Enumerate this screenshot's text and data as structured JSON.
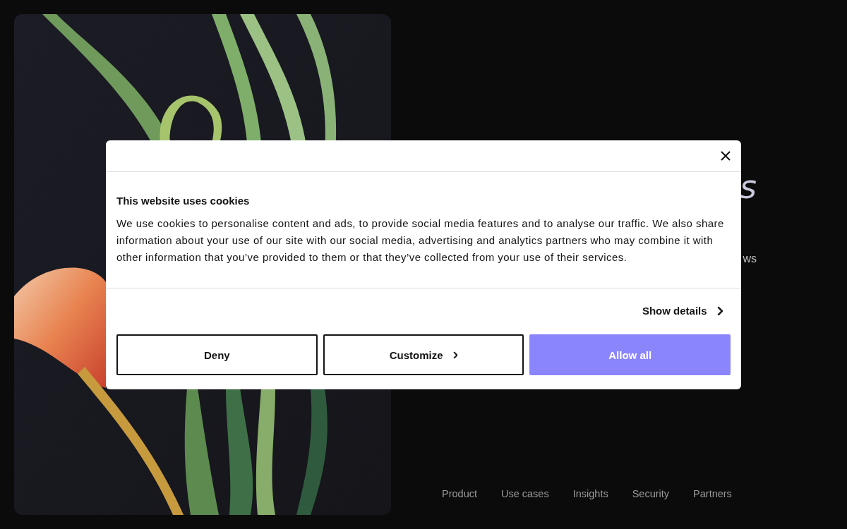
{
  "hero": {
    "heading_fragment": "s",
    "text_fragment": "ws"
  },
  "nav": {
    "items": [
      "Product",
      "Use cases",
      "Insights",
      "Security",
      "Partners"
    ]
  },
  "cookie_dialog": {
    "title": "This website uses cookies",
    "body": "We use cookies to personalise content and ads, to provide social media features and to analyse our traffic. We also share information about your use of our site with our social media, advertising and analytics partners who may combine it with other information that you’ve provided to them or that they’ve collected from your use of their services.",
    "details_link": "Show details",
    "buttons": [
      {
        "label": "Deny",
        "kind": "outline"
      },
      {
        "label": "Customize",
        "kind": "outline-chevron"
      },
      {
        "label": "Allow all",
        "kind": "primary"
      }
    ]
  }
}
